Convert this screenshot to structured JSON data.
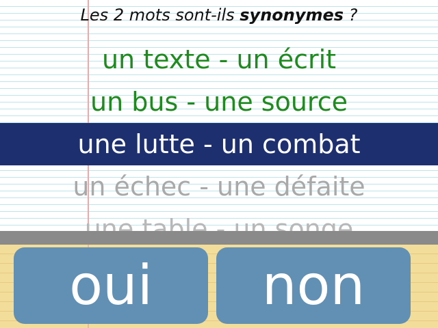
{
  "question": {
    "prefix": "Les 2 mots sont-ils ",
    "keyword": "synonymes",
    "suffix": " ?"
  },
  "pairs": [
    {
      "text": "un texte - un écrit",
      "state": "done"
    },
    {
      "text": "un bus - une source",
      "state": "done"
    },
    {
      "text": "une lutte - un combat",
      "state": "current"
    },
    {
      "text": "un échec - une défaite",
      "state": "upcoming"
    },
    {
      "text": "une table - un songe",
      "state": "upcoming"
    }
  ],
  "buttons": {
    "yes_label": "oui",
    "no_label": "non"
  },
  "colors": {
    "done_text": "#1f8a1f",
    "current_bg": "#1e2f70",
    "upcoming_text": "#a9a9a9",
    "button_bg": "#6290b5",
    "pad_bg": "#f3dd9a"
  }
}
